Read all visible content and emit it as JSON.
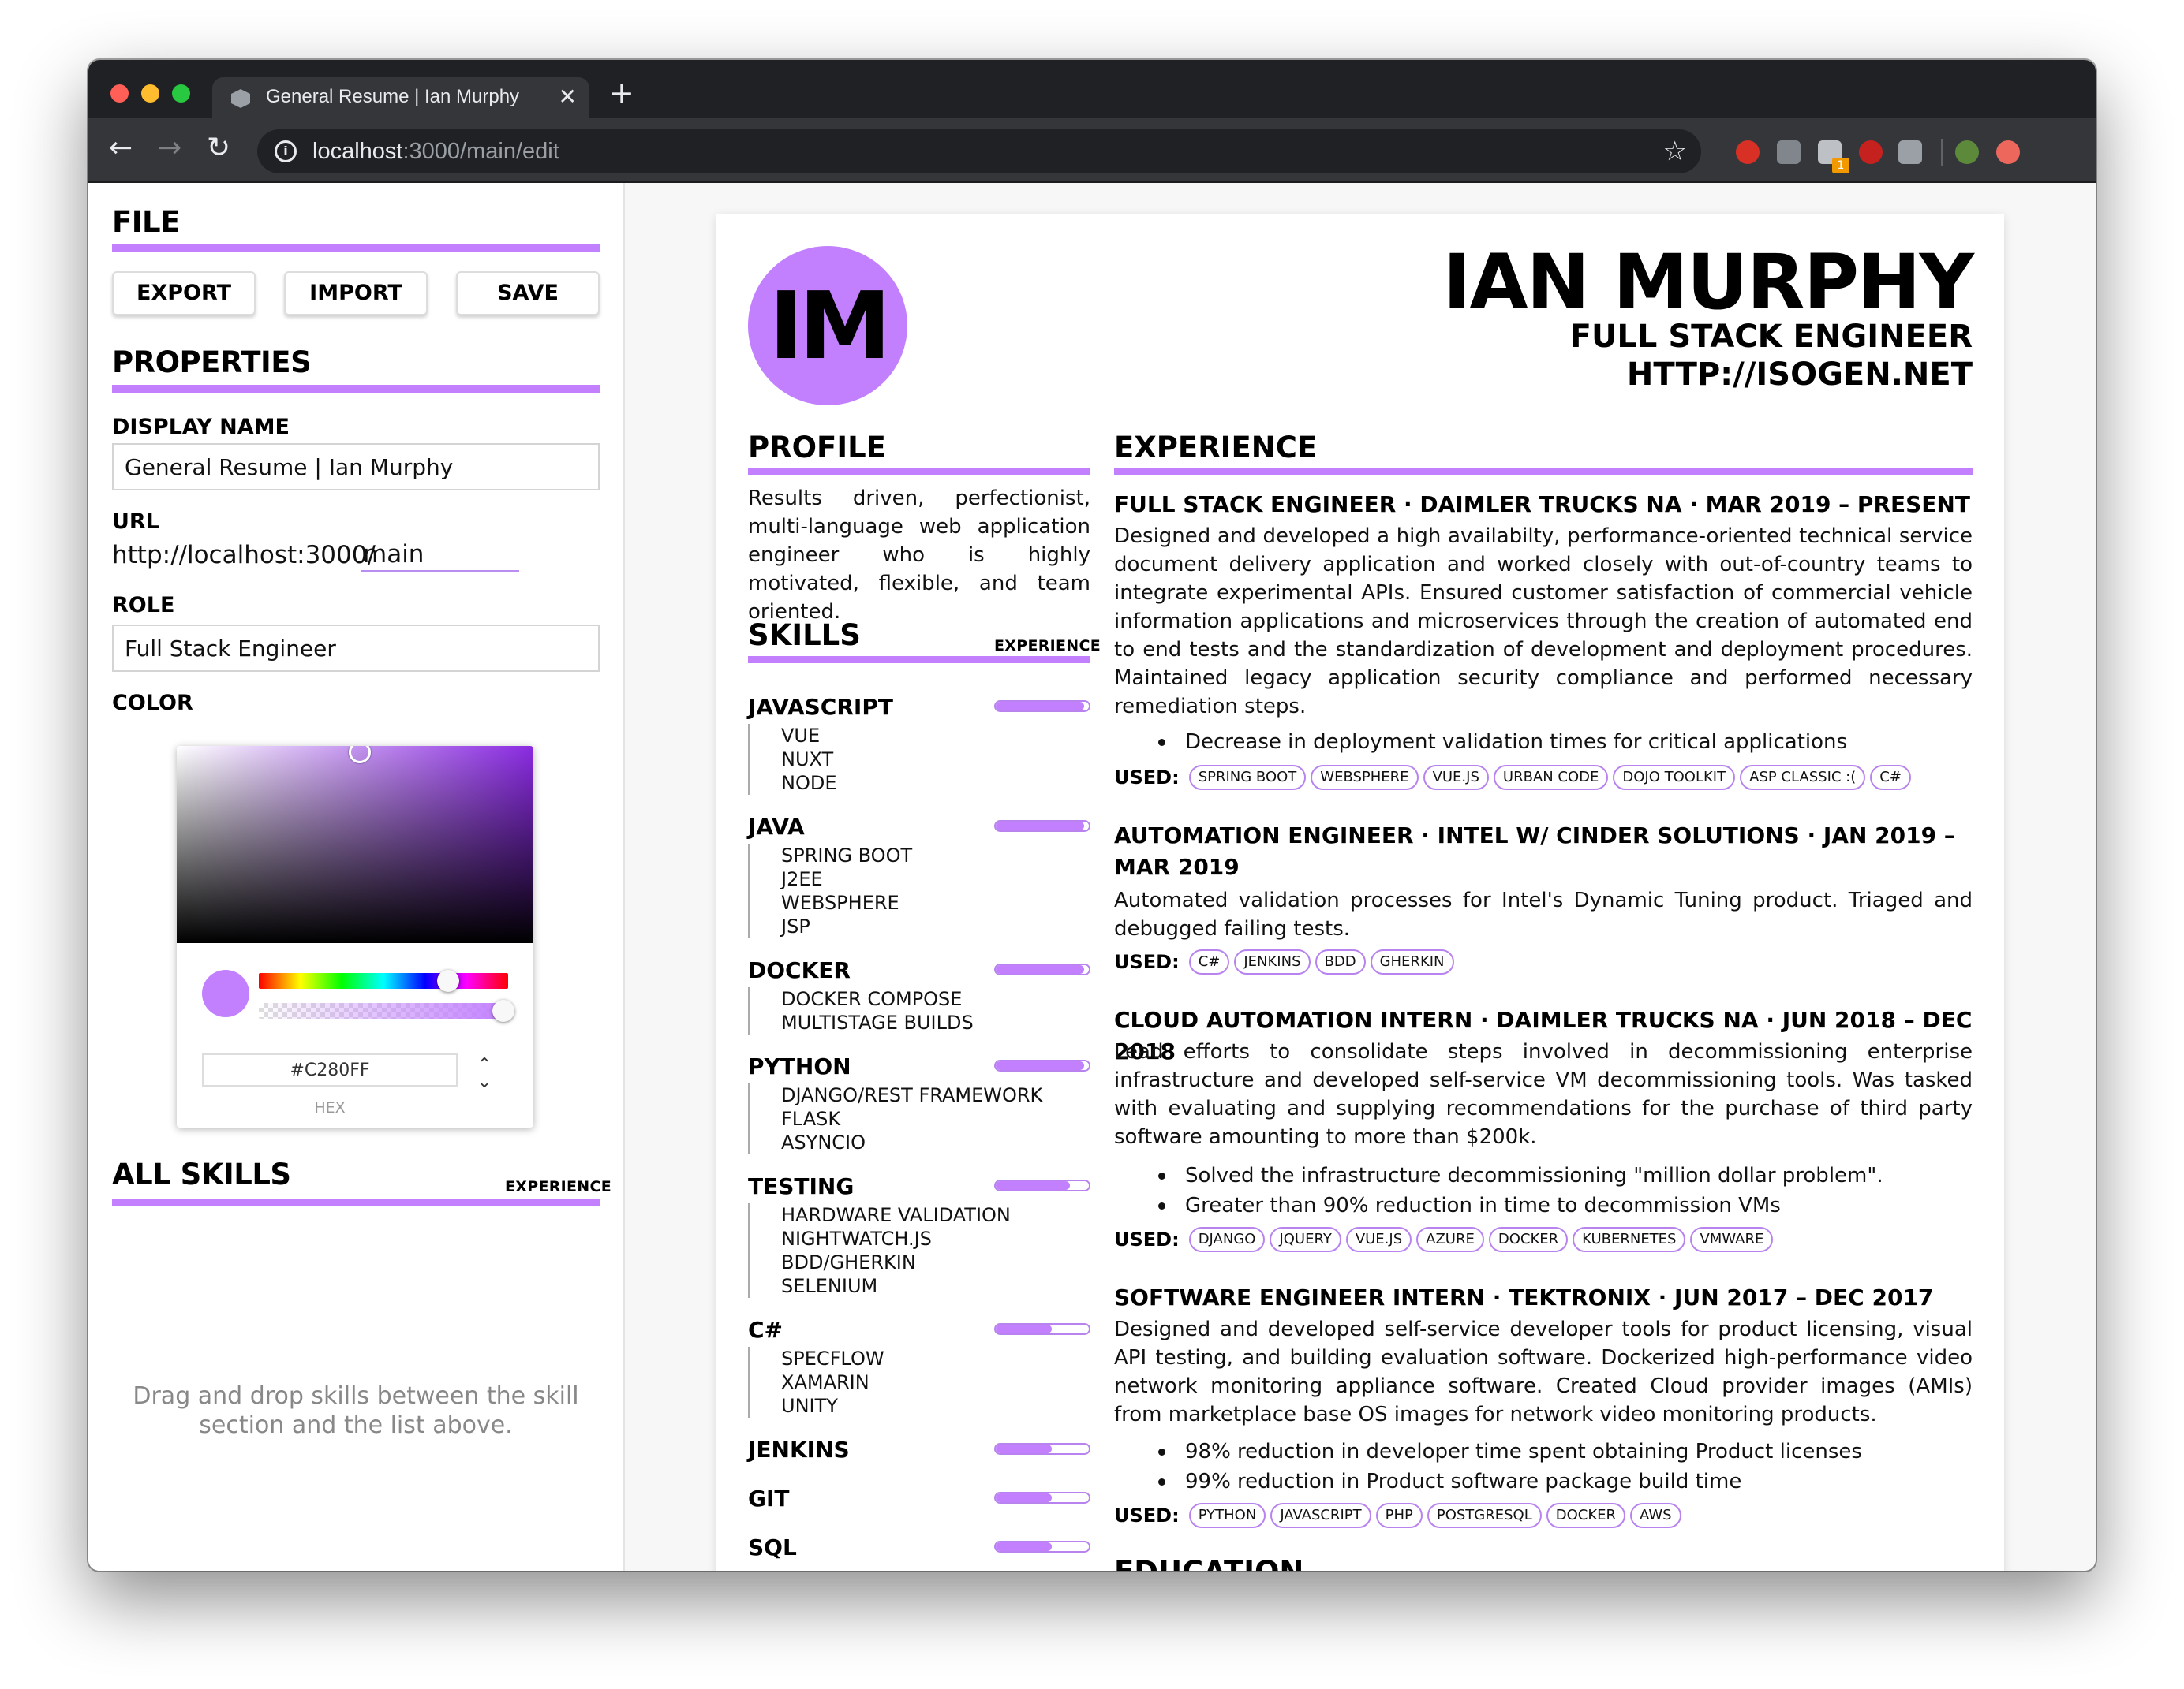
{
  "browser": {
    "tab_title": "General Resume | Ian Murphy",
    "tab_close": "✕",
    "new_tab": "+",
    "url_host": "localhost",
    "url_path": ":3000/main/edit",
    "ext_badge": "1"
  },
  "sidebar": {
    "file_heading": "FILE",
    "buttons": {
      "export": "EXPORT",
      "import": "IMPORT",
      "save": "SAVE"
    },
    "properties_heading": "PROPERTIES",
    "display_name_label": "DISPLAY NAME",
    "display_name_value": "General Resume | Ian Murphy",
    "url_label": "URL",
    "url_prefix": "http://localhost:3000/",
    "url_value": "main",
    "role_label": "ROLE",
    "role_value": "Full Stack Engineer",
    "color_label": "COLOR",
    "color_value": "#C280FF",
    "hex_label": "HEX",
    "all_skills_heading": "ALL SKILLS",
    "all_skills_sublabel": "EXPERIENCE",
    "drag_help": "Drag and drop skills between the skill section and the list above."
  },
  "colors": {
    "accent": "#c280ff",
    "chrome_dark": "#202124"
  },
  "resume": {
    "initials": "IM",
    "name": "IAN MURPHY",
    "role": "FULL STACK ENGINEER",
    "website": "HTTP://ISOGEN.NET",
    "profile_heading": "PROFILE",
    "profile_text": "Results driven, perfectionist, multi-language web application engineer who is highly motivated, flexible, and team oriented.",
    "skills_heading": "SKILLS",
    "skills_sublabel": "EXPERIENCE",
    "skills": [
      {
        "name": "JAVASCRIPT",
        "level": 0.95,
        "subs": [
          "VUE",
          "NUXT",
          "NODE"
        ]
      },
      {
        "name": "JAVA",
        "level": 0.95,
        "subs": [
          "SPRING BOOT",
          "J2EE",
          "WEBSPHERE",
          "JSP"
        ]
      },
      {
        "name": "DOCKER",
        "level": 0.95,
        "subs": [
          "DOCKER COMPOSE",
          "MULTISTAGE BUILDS"
        ]
      },
      {
        "name": "PYTHON",
        "level": 0.95,
        "subs": [
          "DJANGO/REST FRAMEWORK",
          "FLASK",
          "ASYNCIO"
        ]
      },
      {
        "name": "TESTING",
        "level": 0.8,
        "subs": [
          "HARDWARE VALIDATION",
          "NIGHTWATCH.JS",
          "BDD/GHERKIN",
          "SELENIUM"
        ]
      },
      {
        "name": "C#",
        "level": 0.6,
        "subs": [
          "SPECFLOW",
          "XAMARIN",
          "UNITY"
        ]
      },
      {
        "name": "JENKINS",
        "level": 0.6,
        "subs": []
      },
      {
        "name": "GIT",
        "level": 0.6,
        "subs": []
      },
      {
        "name": "SQL",
        "level": 0.6,
        "subs": []
      }
    ],
    "experience_heading": "EXPERIENCE",
    "used_label": "USED:",
    "jobs": [
      {
        "title": "FULL STACK ENGINEER · DAIMLER TRUCKS NA · MAR 2019 – PRESENT",
        "description": "Designed and developed a high availabilty, performance-oriented technical service document delivery application and worked closely with out-of-country teams to integrate experimental APIs. Ensured customer satisfaction of commercial vehicle information applications and microservices through the creation of automated end to end tests and the standardization of development and deployment procedures. Maintained legacy application security compliance and performed necessary remediation steps.",
        "bullets": [
          "Decrease in deployment validation times for critical applications"
        ],
        "used": [
          "SPRING BOOT",
          "WEBSPHERE",
          "VUE.JS",
          "URBAN CODE",
          "DOJO TOOLKIT",
          "ASP CLASSIC :(",
          "C#"
        ]
      },
      {
        "title": "AUTOMATION ENGINEER · INTEL W/ CINDER SOLUTIONS · JAN 2019 – MAR 2019",
        "description": "Automated validation processes for Intel's Dynamic Tuning product. Triaged and debugged failing tests.",
        "bullets": [],
        "used": [
          "C#",
          "JENKINS",
          "BDD",
          "GHERKIN"
        ]
      },
      {
        "title": "CLOUD AUTOMATION INTERN · DAIMLER TRUCKS NA · JUN 2018 – DEC 2018",
        "description": "Lead efforts to consolidate steps involved in decommissioning enterprise infrastructure and developed self-service VM decommissioning tools. Was tasked with evaluating and supplying recommendations for the purchase of third party software amounting to more than $200k.",
        "bullets": [
          "Solved the infrastructure decommissioning \"million dollar problem\".",
          "Greater than 90% reduction in time to decommission VMs"
        ],
        "used": [
          "DJANGO",
          "JQUERY",
          "VUE.JS",
          "AZURE",
          "DOCKER",
          "KUBERNETES",
          "VMWARE"
        ]
      },
      {
        "title": "SOFTWARE ENGINEER INTERN · TEKTRONIX · JUN 2017 – DEC 2017",
        "description": "Designed and developed self-service developer tools for product licensing, visual API testing, and building evaluation software. Dockerized high-performance video network monitoring appliance software. Created Cloud provider images (AMIs) from marketplace base OS images for network video monitoring products.",
        "bullets": [
          "98% reduction in developer time spent obtaining Product licenses",
          "99% reduction in Product software package build time"
        ],
        "used": [
          "PYTHON",
          "JAVASCRIPT",
          "PHP",
          "POSTGRESQL",
          "DOCKER",
          "AWS"
        ]
      }
    ],
    "education_heading": "EDUCATION"
  }
}
